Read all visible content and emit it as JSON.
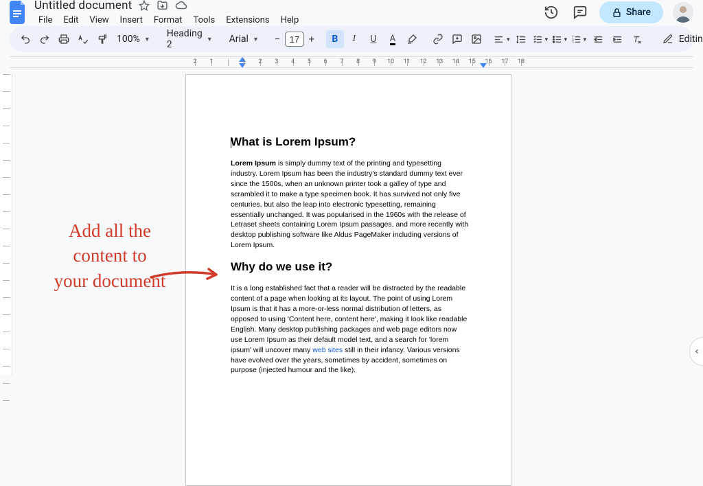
{
  "header": {
    "doc_title": "Untitled document",
    "menus": [
      "File",
      "Edit",
      "View",
      "Insert",
      "Format",
      "Tools",
      "Extensions",
      "Help"
    ],
    "share_label": "Share"
  },
  "toolbar": {
    "zoom": "100%",
    "style_select": "Heading 2",
    "font_select": "Arial",
    "font_size": "17",
    "editing_label": "Editing"
  },
  "ruler": {
    "h_labels": [
      "2",
      "1",
      "",
      "1",
      "2",
      "3",
      "4",
      "5",
      "6",
      "7",
      "8",
      "9",
      "10",
      "11",
      "12",
      "13",
      "14",
      "15",
      "16",
      "17",
      "18"
    ]
  },
  "document": {
    "h1": "What is Lorem Ipsum?",
    "p1_lead": "Lorem Ipsum",
    "p1_rest": " is simply dummy text of the printing and typesetting industry. Lorem Ipsum has been the industry's standard dummy text ever since the 1500s, when an unknown printer took a galley of type and scrambled it to make a type specimen book. It has survived not only five centuries, but also the leap into electronic typesetting, remaining essentially unchanged. It was popularised in the 1960s with the release of Letraset sheets containing Lorem Ipsum passages, and more recently with desktop publishing software like Aldus PageMaker including versions of Lorem Ipsum.",
    "h2": "Why do we use it?",
    "p2_a": "It is a long established fact that a reader will be distracted by the readable content of a page when looking at its layout. The point of using Lorem Ipsum is that it has a more-or-less normal distribution of letters, as opposed to using 'Content here, content here', making it look like readable English. Many desktop publishing packages and web page editors now use Lorem Ipsum as their default model text, and a search for 'lorem ipsum' will uncover many ",
    "p2_link": "web sites",
    "p2_b": " still in their infancy. Various versions have evolved over the years, sometimes by accident, sometimes on purpose (injected humour and the like)."
  },
  "annotation": {
    "line1": "Add all the",
    "line2": "content to",
    "line3": "your document"
  }
}
